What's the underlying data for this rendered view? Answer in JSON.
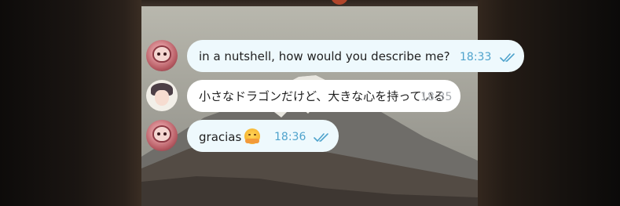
{
  "messages": [
    {
      "sender": "dragon",
      "direction": "outgoing",
      "text": "in a nutshell, how would you describe me?",
      "time": "18:33",
      "status": "read",
      "avatar_icon": "dragon-avatar-icon"
    },
    {
      "sender": "person",
      "direction": "incoming",
      "text": "小さなドラゴンだけど、大きな心を持っている",
      "time": "18:35",
      "avatar_icon": "person-avatar-icon"
    },
    {
      "sender": "dragon",
      "direction": "outgoing",
      "text": "gracias",
      "emoji": "smiling-face-with-open-hands-emoji",
      "time": "18:36",
      "status": "read",
      "avatar_icon": "dragon-avatar-icon"
    }
  ],
  "colors": {
    "outgoing_bubble": "#eef9fd",
    "incoming_bubble": "#ffffff",
    "outgoing_time": "#4fa3cc",
    "incoming_time": "#a6aaaf",
    "read_ticks": "#4fa3cc"
  }
}
